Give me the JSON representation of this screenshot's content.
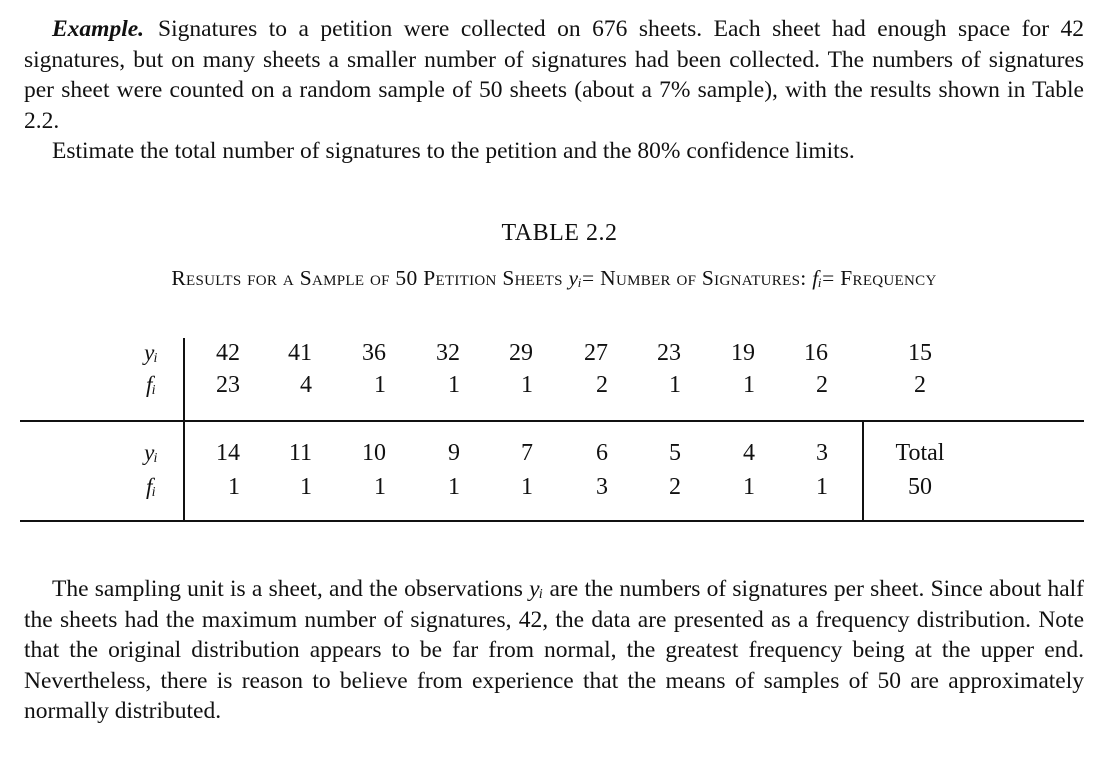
{
  "intro": {
    "lead": "Example.",
    "line1": "Signatures to a petition were collected on 676 sheets. Each sheet had enough space for 42 signatures, but on many sheets a smaller number of signatures had been collected. The numbers of signatures per sheet were counted on a random sample of 50 sheets (about a 7% sample), with the results shown in Table 2.2.",
    "line2": "Estimate the total number of signatures to the petition and the 80% confidence limits."
  },
  "table": {
    "title": "TABLE 2.2",
    "caption_part1": "Results for a Sample of 50 Petition Sheets",
    "caption_y": "yᵢ",
    "caption_part2": "= Number of Signatures:",
    "caption_f": "fᵢ",
    "caption_part3": "= Frequency",
    "row_label_y": "yᵢ",
    "row_label_f": "fᵢ",
    "block1": {
      "y": [
        "42",
        "41",
        "36",
        "32",
        "29",
        "27",
        "23",
        "19",
        "16",
        "15"
      ],
      "f": [
        "23",
        "4",
        "1",
        "1",
        "1",
        "2",
        "1",
        "1",
        "2",
        "2"
      ]
    },
    "block2": {
      "y": [
        "14",
        "11",
        "10",
        "9",
        "7",
        "6",
        "5",
        "4",
        "3",
        "Total"
      ],
      "f": [
        "1",
        "1",
        "1",
        "1",
        "1",
        "3",
        "2",
        "1",
        "1",
        "50"
      ]
    }
  },
  "outro": {
    "part1": "The sampling unit is a sheet, and the observations",
    "y": "yᵢ",
    "part2": "are the numbers of signatures per sheet. Since about half the sheets had the maximum number of signatures, 42, the data are presented as a frequency distribution. Note that the original distribution appears to be far from normal, the greatest frequency being at the upper end. Nevertheless, there is reason to believe from experience that the means of samples of 50 are approximately normally distributed."
  }
}
